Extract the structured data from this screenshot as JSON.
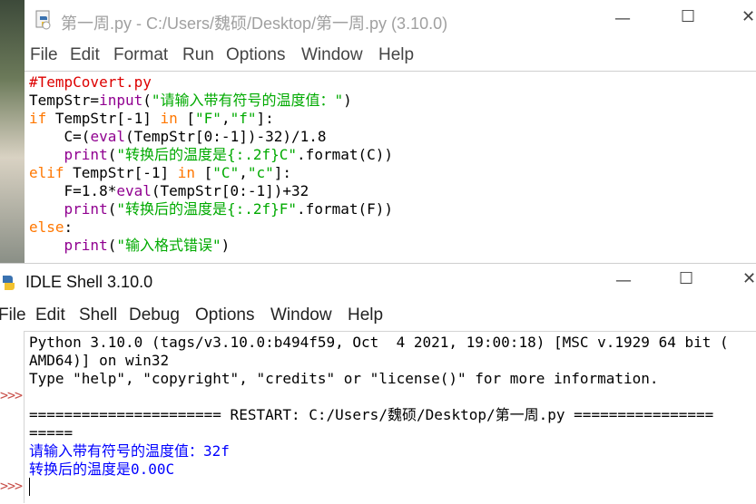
{
  "editor": {
    "title": "第一周.py - C:/Users/魏硕/Desktop/第一周.py (3.10.0)",
    "menu": [
      "File",
      "Edit",
      "Format",
      "Run",
      "Options",
      "Window",
      "Help"
    ],
    "window_controls": {
      "minimize": "—",
      "maximize": "☐",
      "close": "✕"
    }
  },
  "code": {
    "line1_comment": "#TempCovert.py",
    "line2_a": "TempStr=",
    "line2_fn": "input",
    "line2_b": "(",
    "line2_str": "\"请输入带有符号的温度值：\"",
    "line2_c": ")",
    "line3_kw": "if",
    "line3_a": " TempStr[-1] ",
    "line3_kw2": "in",
    "line3_b": " [",
    "line3_str1": "\"F\"",
    "line3_c": ",",
    "line3_str2": "\"f\"",
    "line3_d": "]:",
    "line4_a": "    C=(",
    "line4_fn": "eval",
    "line4_b": "(TempStr[0:-1])-32)/1.8",
    "line5_a": "    ",
    "line5_fn": "print",
    "line5_b": "(",
    "line5_str": "\"转换后的温度是{:.2f}C\"",
    "line5_c": ".format(C))",
    "line6_kw": "elif",
    "line6_a": " TempStr[-1] ",
    "line6_kw2": "in",
    "line6_b": " [",
    "line6_str1": "\"C\"",
    "line6_c": ",",
    "line6_str2": "\"c\"",
    "line6_d": "]:",
    "line7_a": "    F=1.8*",
    "line7_fn": "eval",
    "line7_b": "(TempStr[0:-1])+32",
    "line8_a": "    ",
    "line8_fn": "print",
    "line8_b": "(",
    "line8_str": "\"转换后的温度是{:.2f}F\"",
    "line8_c": ".format(F))",
    "line9_kw": "else",
    "line9_a": ":",
    "line10_a": "    ",
    "line10_fn": "print",
    "line10_b": "(",
    "line10_str": "\"输入格式错误\"",
    "line10_c": ")"
  },
  "shell": {
    "title": "IDLE Shell 3.10.0",
    "menu": [
      "File",
      "Edit",
      "Shell",
      "Debug",
      "Options",
      "Window",
      "Help"
    ],
    "window_controls": {
      "minimize": "—",
      "maximize": "☐",
      "close": "✕"
    },
    "prompt": ">>>",
    "lines": [
      "Python 3.10.0 (tags/v3.10.0:b494f59, Oct  4 2021, 19:00:18) [MSC v.1929 64 bit (",
      "AMD64)] on win32",
      "Type \"help\", \"copyright\", \"credits\" or \"license()\" for more information.",
      "",
      "====================== RESTART: C:/Users/魏硕/Desktop/第一周.py ================",
      "=====",
      "请输入带有符号的温度值：32f",
      "转换后的温度是0.00C"
    ]
  },
  "colors": {
    "keyword": "#ff7700",
    "builtin": "#900090",
    "string": "#00aa00",
    "comment": "#dd0000",
    "stdout": "#0000ff",
    "prompt": "#c8504a"
  }
}
